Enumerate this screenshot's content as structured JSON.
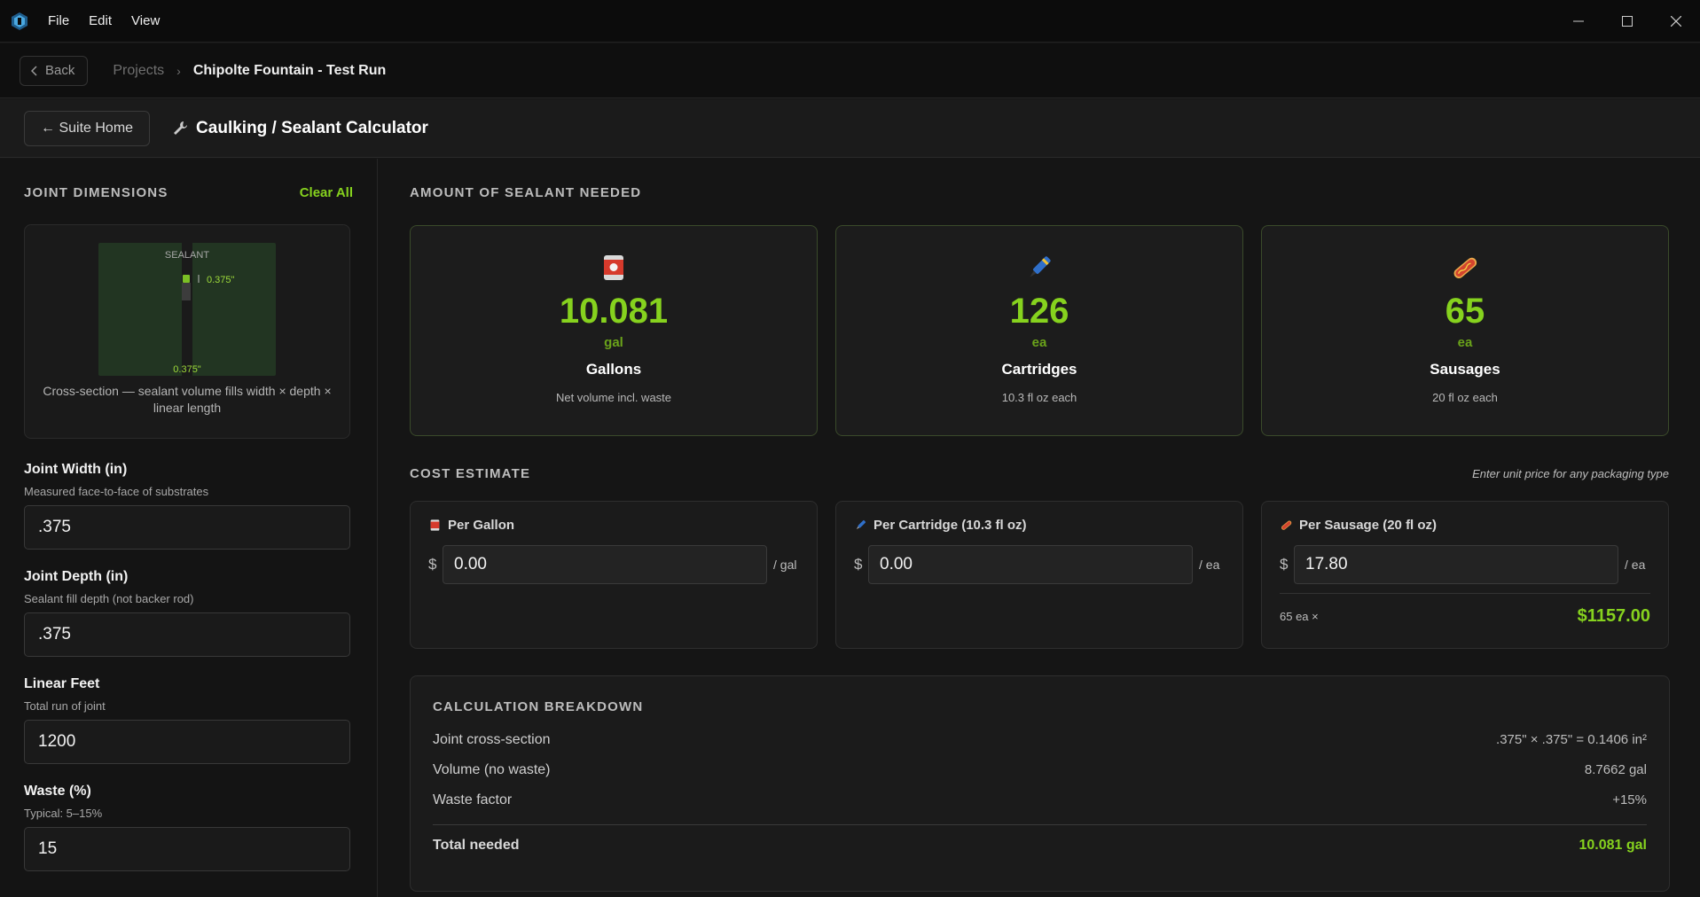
{
  "menu": {
    "file": "File",
    "edit": "Edit",
    "view": "View"
  },
  "breadcrumb": {
    "back": "Back",
    "projects": "Projects",
    "current": "Chipolte Fountain - Test Run"
  },
  "header": {
    "suite_home": "← Suite Home",
    "title": "Caulking / Sealant Calculator"
  },
  "left": {
    "section_title": "JOINT DIMENSIONS",
    "clear_all": "Clear All",
    "diagram": {
      "sealant_label": "SEALANT",
      "depth_label": "0.375\"",
      "width_label": "0.375\"",
      "caption": "Cross-section — sealant volume fills width × depth × linear length"
    },
    "fields": [
      {
        "label": "Joint Width (in)",
        "help": "Measured face-to-face of substrates",
        "value": ".375"
      },
      {
        "label": "Joint Depth (in)",
        "help": "Sealant fill depth (not backer rod)",
        "value": ".375"
      },
      {
        "label": "Linear Feet",
        "help": "Total run of joint",
        "value": "1200"
      },
      {
        "label": "Waste (%)",
        "help": "Typical: 5–15%",
        "value": "15"
      }
    ]
  },
  "results": {
    "section_title": "AMOUNT OF SEALANT NEEDED",
    "cards": [
      {
        "icon": "can-icon",
        "value": "10.081",
        "unit": "gal",
        "label": "Gallons",
        "note": "Net volume incl. waste"
      },
      {
        "icon": "caulk-gun-icon",
        "value": "126",
        "unit": "ea",
        "label": "Cartridges",
        "note": "10.3 fl oz each"
      },
      {
        "icon": "sausage-icon",
        "value": "65",
        "unit": "ea",
        "label": "Sausages",
        "note": "20 fl oz each"
      }
    ]
  },
  "cost": {
    "section_title": "COST ESTIMATE",
    "hint": "Enter unit price for any packaging type",
    "currency": "$",
    "cards": [
      {
        "title": "Per Gallon",
        "value": "0.00",
        "per": "/ gal"
      },
      {
        "title": "Per Cartridge (10.3 fl oz)",
        "value": "0.00",
        "per": "/ ea"
      },
      {
        "title": "Per Sausage (20 fl oz)",
        "value": "17.80",
        "per": "/ ea",
        "qty": "65 ea ×",
        "total": "$1157.00"
      }
    ]
  },
  "breakdown": {
    "title": "CALCULATION BREAKDOWN",
    "rows": [
      {
        "label": "Joint cross-section",
        "value": ".375\" × .375\" = 0.1406 in²"
      },
      {
        "label": "Volume (no waste)",
        "value": "8.7662 gal"
      },
      {
        "label": "Waste factor",
        "value": "+15%"
      }
    ],
    "total_label": "Total needed",
    "total_value": "10.081 gal"
  },
  "colors": {
    "accent": "#86d21e",
    "background": "#151515",
    "card": "#1c1c1c"
  }
}
